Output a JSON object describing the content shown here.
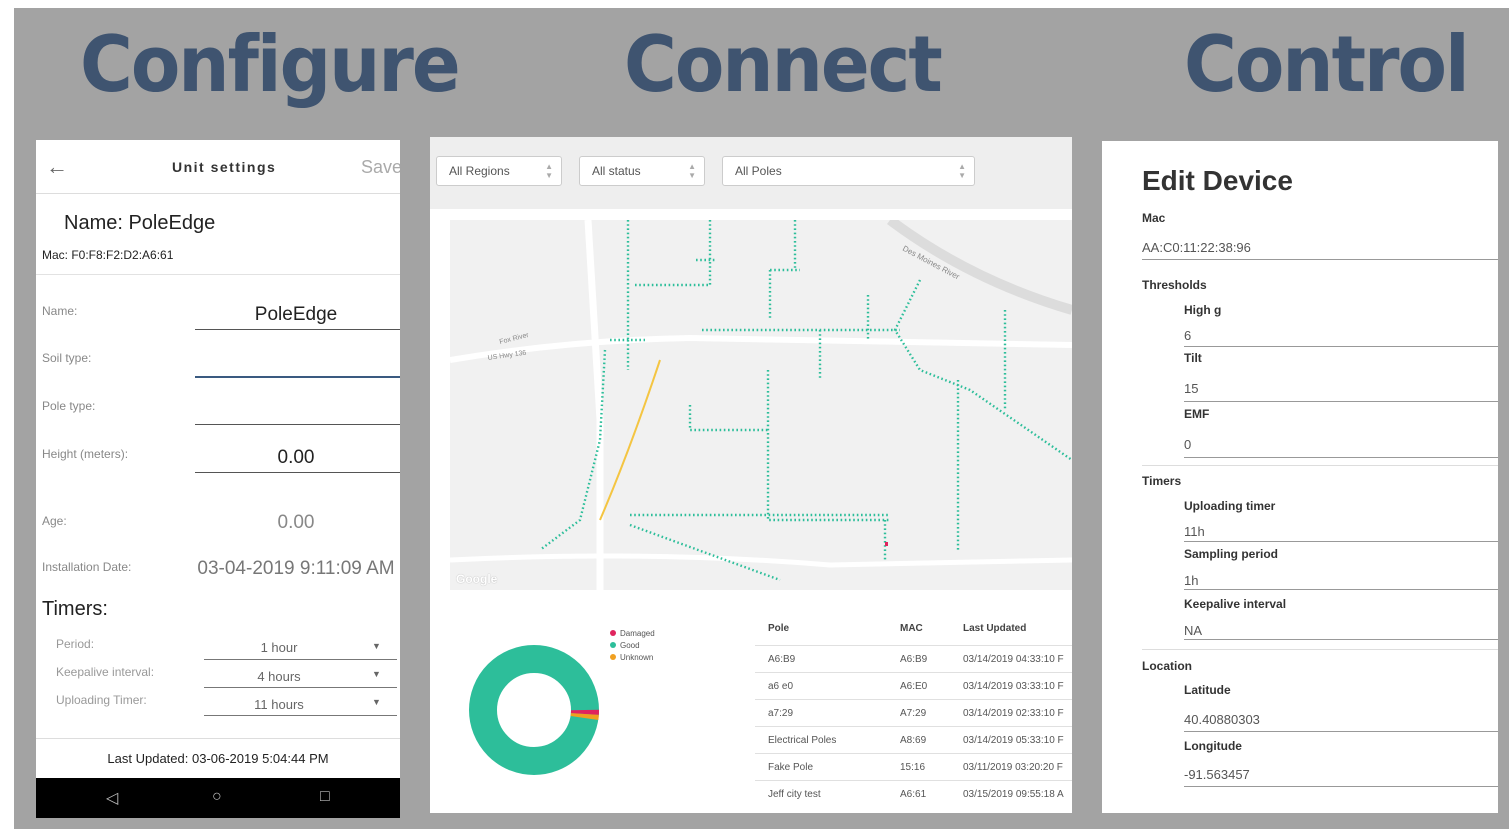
{
  "headings": {
    "configure": "Configure",
    "connect": "Connect",
    "control": "Control"
  },
  "configure": {
    "title": "Unit settings",
    "save_label": "Save",
    "name_display": "Name: PoleEdge",
    "mac_display": "Mac: F0:F8:F2:D2:A6:61",
    "fields": {
      "name": {
        "label": "Name:",
        "value": "PoleEdge"
      },
      "soil_type": {
        "label": "Soil type:",
        "value": ""
      },
      "pole_type": {
        "label": "Pole type:",
        "value": ""
      },
      "height": {
        "label": "Height (meters):",
        "value": "0.00"
      },
      "age": {
        "label": "Age:",
        "value": "0.00"
      },
      "installation_date": {
        "label": "Installation Date:",
        "value": "03-04-2019 9:11:09 AM"
      }
    },
    "timers_heading": "Timers:",
    "timers": {
      "period": {
        "label": "Period:",
        "value": "1 hour"
      },
      "keepalive": {
        "label": "Keepalive interval:",
        "value": "4 hours"
      },
      "uploading": {
        "label": "Uploading Timer:",
        "value": "11 hours"
      }
    },
    "last_updated": "Last Updated: 03-06-2019 5:04:44 PM",
    "nav_icons": [
      "back-triangle-icon",
      "home-circle-icon",
      "recents-square-icon"
    ]
  },
  "connect": {
    "filters": {
      "region": "All Regions",
      "status": "All status",
      "poles": "All Poles"
    },
    "map_labels": {
      "road1": "Des Moines River",
      "road2": "Fox River",
      "road3": "US Hwy 136",
      "logo": "Google"
    },
    "legend": [
      {
        "label": "Damaged",
        "color": "#e0245e"
      },
      {
        "label": "Good",
        "color": "#2dbe9a"
      },
      {
        "label": "Unknown",
        "color": "#f0a020"
      }
    ],
    "donut": {
      "good": 0.985,
      "damaged": 0.005,
      "unknown": 0.01
    },
    "table": {
      "headers": [
        "Pole",
        "MAC",
        "Last Updated"
      ],
      "rows": [
        [
          "A6:B9",
          "A6:B9",
          "03/14/2019 04:33:10 F"
        ],
        [
          "a6 e0",
          "A6:E0",
          "03/14/2019 03:33:10 F"
        ],
        [
          "a7:29",
          "A7:29",
          "03/14/2019 02:33:10 F"
        ],
        [
          "Electrical Poles",
          "A8:69",
          "03/14/2019 05:33:10 F"
        ],
        [
          "Fake Pole",
          "15:16",
          "03/11/2019 03:20:20 F"
        ],
        [
          "Jeff city test",
          "A6:61",
          "03/15/2019 09:55:18 A"
        ]
      ]
    }
  },
  "control": {
    "title": "Edit Device",
    "mac_label": "Mac",
    "mac_value": "AA:C0:11:22:38:96",
    "thresholds_label": "Thresholds",
    "thresholds": [
      {
        "label": "High g",
        "value": "6"
      },
      {
        "label": "Tilt",
        "value": "15"
      },
      {
        "label": "EMF",
        "value": "0"
      }
    ],
    "timers_label": "Timers",
    "timers": [
      {
        "label": "Uploading timer",
        "value": "11h"
      },
      {
        "label": "Sampling period",
        "value": "1h"
      },
      {
        "label": "Keepalive interval",
        "value": "NA"
      }
    ],
    "location_label": "Location",
    "location": [
      {
        "label": "Latitude",
        "value": "40.40880303"
      },
      {
        "label": "Longitude",
        "value": "-91.563457"
      }
    ]
  },
  "colors": {
    "frame": "#a3a3a3",
    "heading": "#3f5470",
    "good": "#2dbe9a",
    "damaged": "#e0245e",
    "unknown": "#f0a020"
  }
}
